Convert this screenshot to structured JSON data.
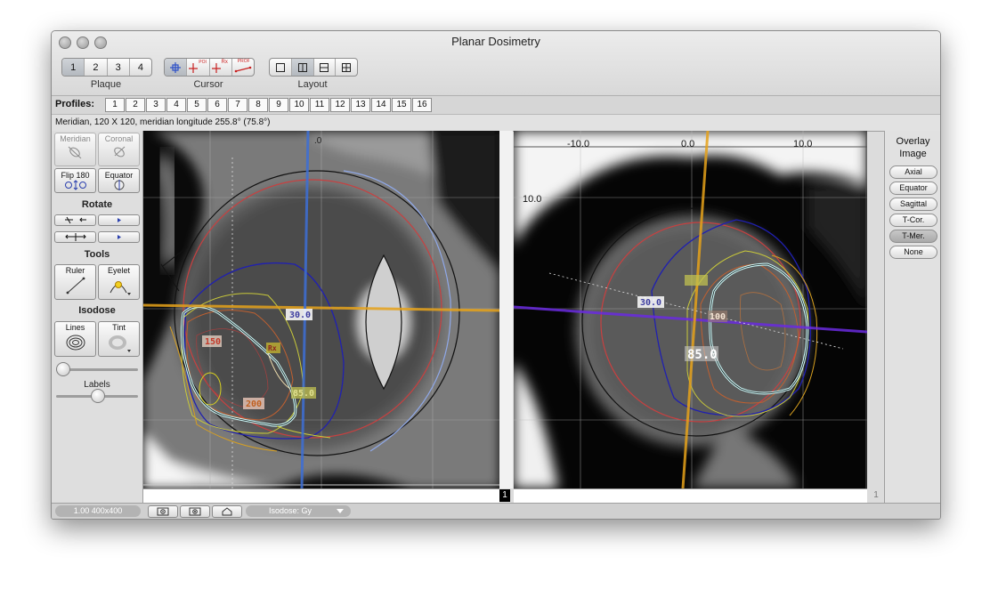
{
  "window": {
    "title": "Planar Dosimetry"
  },
  "toolbar": {
    "plaque": {
      "label": "Plaque",
      "options": [
        "1",
        "2",
        "3",
        "4"
      ],
      "selected": "1"
    },
    "cursor": {
      "label": "Cursor",
      "tools": [
        "crosshair-icon",
        "poi-cursor-icon",
        "rx-cursor-icon",
        "profile-cursor-icon"
      ],
      "poi_text": "POI",
      "rx_text": "Rx",
      "prof_text": "PROF"
    },
    "layout": {
      "label": "Layout",
      "options": [
        "single-pane-icon",
        "two-pane-vertical-icon",
        "two-pane-horizontal-icon",
        "four-pane-icon"
      ],
      "selected": 1
    }
  },
  "profiles": {
    "label": "Profiles:",
    "items": [
      "1",
      "2",
      "3",
      "4",
      "5",
      "6",
      "7",
      "8",
      "9",
      "10",
      "11",
      "12",
      "13",
      "14",
      "15",
      "16"
    ]
  },
  "status": {
    "text": "Meridian, 120 X 120, meridian longitude 255.8° (75.8°)"
  },
  "left_panel": {
    "meridian": "Meridian",
    "coronal": "Coronal",
    "flip": "Flip 180",
    "equator": "Equator",
    "rotate_title": "Rotate",
    "tools_title": "Tools",
    "ruler": "Ruler",
    "eyelet": "Eyelet",
    "isodose_title": "Isodose",
    "lines": "Lines",
    "tint": "Tint",
    "labels_title": "Labels",
    "slider1_value": 0.0,
    "slider2_value": 0.5
  },
  "left_view": {
    "frame": "1",
    "tick_top": ".0",
    "iso_labels": [
      "30.0",
      "150",
      "Rx",
      "200",
      "85.0"
    ]
  },
  "right_view": {
    "frame": "1",
    "x_ticks": [
      "-10.0",
      "0.0",
      "10.0"
    ],
    "y_tick": "10.0",
    "iso_labels": [
      "30.0",
      "100",
      "85.0"
    ]
  },
  "overlay": {
    "title_line1": "Overlay",
    "title_line2": "Image",
    "options": [
      "Axial",
      "Equator",
      "Sagittal",
      "T-Cor.",
      "T-Mer.",
      "None"
    ],
    "selected": "T-Mer."
  },
  "bottom_bar": {
    "zoom": "1.00 400x400",
    "isodose_menu": "Isodose: Gy"
  },
  "colors": {
    "accent_blue": "#3d6fd6",
    "orange_line": "#e6a21a",
    "purple_line": "#6a2be0",
    "rx_cyan": "#c9f5f5"
  }
}
